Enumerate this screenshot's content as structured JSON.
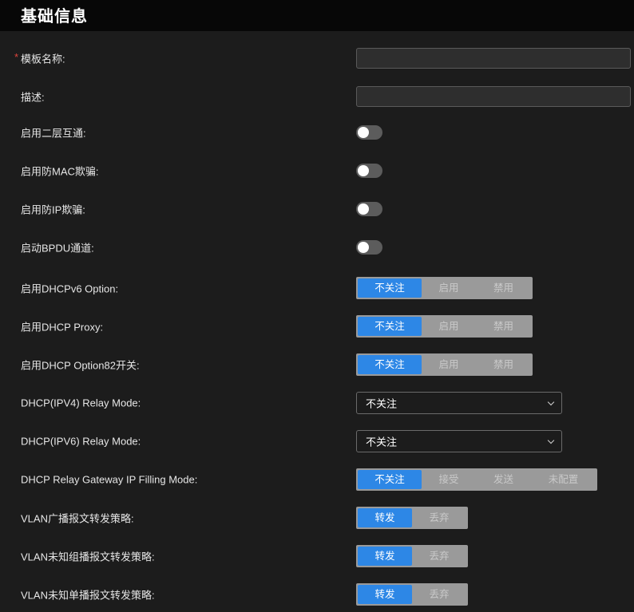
{
  "section": {
    "title": "基础信息"
  },
  "fields": {
    "template_name": {
      "required_mark": "*",
      "label": "模板名称:",
      "value": ""
    },
    "description": {
      "label": "描述:",
      "value": ""
    },
    "l2_interop": {
      "label": "启用二层互通:",
      "enabled": false
    },
    "mac_spoof": {
      "label": "启用防MAC欺骗:",
      "enabled": false
    },
    "ip_spoof": {
      "label": "启用防IP欺骗:",
      "enabled": false
    },
    "bpdu": {
      "label": "启动BPDU通道:",
      "enabled": false
    },
    "dhcpv6_option": {
      "label": "启用DHCPv6 Option:",
      "options": [
        "不关注",
        "启用",
        "禁用"
      ],
      "selected": "不关注"
    },
    "dhcp_proxy": {
      "label": "启用DHCP Proxy:",
      "options": [
        "不关注",
        "启用",
        "禁用"
      ],
      "selected": "不关注"
    },
    "dhcp_option82": {
      "label": "启用DHCP Option82开关:",
      "options": [
        "不关注",
        "启用",
        "禁用"
      ],
      "selected": "不关注"
    },
    "ipv4_relay_mode": {
      "label": "DHCP(IPV4) Relay Mode:",
      "value": "不关注"
    },
    "ipv6_relay_mode": {
      "label": "DHCP(IPV6) Relay Mode:",
      "value": "不关注"
    },
    "relay_gateway": {
      "label": "DHCP Relay Gateway IP Filling Mode:",
      "options": [
        "不关注",
        "接受",
        "发送",
        "未配置"
      ],
      "selected": "不关注"
    },
    "vlan_broadcast": {
      "label": "VLAN广播报文转发策略:",
      "options": [
        "转发",
        "丢弃"
      ],
      "selected": "转发"
    },
    "vlan_unknown_multicast": {
      "label": "VLAN未知组播报文转发策略:",
      "options": [
        "转发",
        "丢弃"
      ],
      "selected": "转发"
    },
    "vlan_unknown_unicast": {
      "label": "VLAN未知单播报文转发策略:",
      "options": [
        "转发",
        "丢弃"
      ],
      "selected": "转发"
    }
  },
  "colors": {
    "accent": "#2d87e6",
    "background": "#1c1c1c",
    "header": "#070707",
    "required": "#e0453c",
    "toggle_off": "#5c5c5c"
  },
  "icons": {
    "select_arrow": "chevron-down-icon"
  }
}
